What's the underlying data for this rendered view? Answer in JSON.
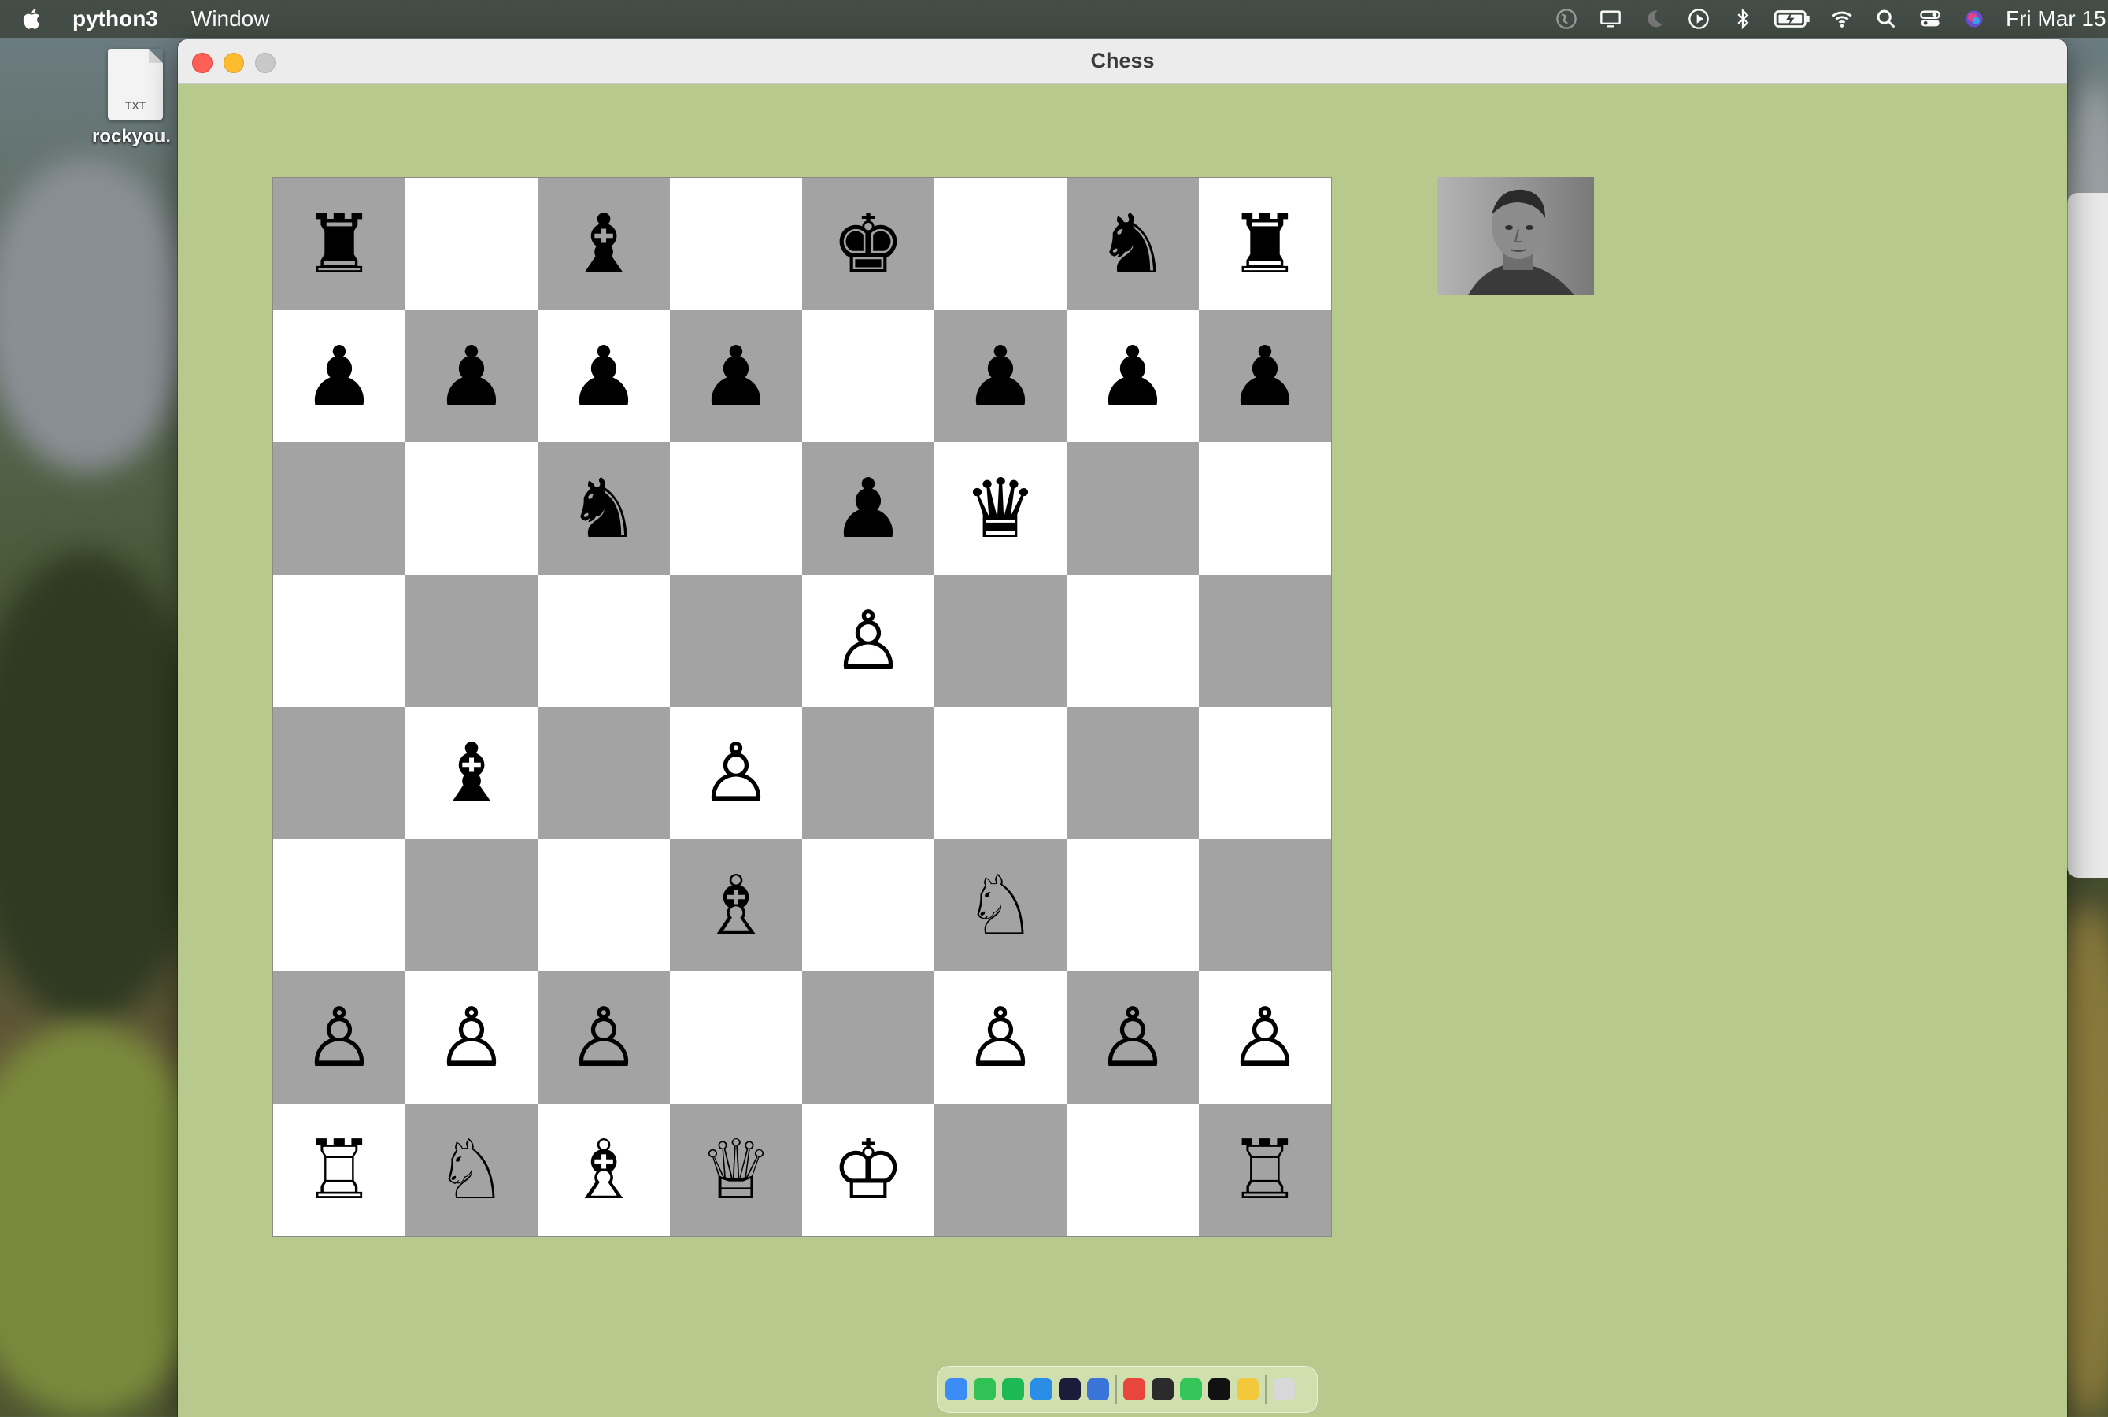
{
  "menubar": {
    "app_name": "python3",
    "menu_items": [
      "Window"
    ],
    "clock": "Fri Mar 15",
    "status_icons": [
      "globe-icon",
      "display-icon",
      "moon-icon",
      "play-icon",
      "bluetooth-icon",
      "battery-icon",
      "wifi-icon",
      "search-icon",
      "control-center-icon",
      "siri-icon"
    ]
  },
  "desktop": {
    "file": {
      "ext": "TXT",
      "name": "rockyou."
    }
  },
  "window": {
    "title": "Chess"
  },
  "board": {
    "light_color": "#ffffff",
    "dark_color": "#a3a3a3",
    "background_color": "#b7c98d",
    "ranks": [
      [
        "br",
        "",
        "bb",
        "",
        "bk",
        "",
        "bn",
        "br"
      ],
      [
        "bp",
        "bp",
        "bp",
        "bp",
        "",
        "bp",
        "bp",
        "bp"
      ],
      [
        "",
        "",
        "bn",
        "",
        "bp",
        "bq",
        "",
        ""
      ],
      [
        "",
        "",
        "",
        "",
        "wp",
        "",
        "",
        ""
      ],
      [
        "",
        "bb",
        "",
        "wp",
        "",
        "",
        "",
        ""
      ],
      [
        "",
        "",
        "",
        "wb",
        "",
        "wn",
        "",
        ""
      ],
      [
        "wp",
        "wp",
        "wp",
        "",
        "",
        "wp",
        "wp",
        "wp"
      ],
      [
        "wr",
        "wn",
        "wb",
        "wq",
        "wk",
        "",
        "",
        "wr"
      ]
    ]
  },
  "glyphs": {
    "bk": "♚",
    "bq": "♛",
    "br": "♜",
    "bb": "♝",
    "bn": "♞",
    "bp": "♟",
    "wk": "♔",
    "wq": "♕",
    "wr": "♖",
    "wb": "♗",
    "wn": "♘",
    "wp": "♙"
  },
  "piece_names": {
    "k": "king",
    "q": "queen",
    "r": "rook",
    "b": "bishop",
    "n": "knight",
    "p": "pawn",
    "b_": "black",
    "w_": "white"
  },
  "dock": {
    "apps": [
      {
        "name": "finder",
        "color": "#3b8df5"
      },
      {
        "name": "facetime",
        "color": "#30c254"
      },
      {
        "name": "spotify",
        "color": "#1db954"
      },
      {
        "name": "vscode",
        "color": "#2a8ee6"
      },
      {
        "name": "intellij",
        "color": "#1b1b3a"
      },
      {
        "name": "xcode",
        "color": "#3a74d9"
      },
      {
        "sep": true
      },
      {
        "name": "chrome",
        "color": "#e8453c"
      },
      {
        "name": "terminal-dark",
        "color": "#2b2b2b"
      },
      {
        "name": "messages",
        "color": "#35c659"
      },
      {
        "name": "terminal",
        "color": "#111111"
      },
      {
        "name": "cyberduck",
        "color": "#f3c93c"
      },
      {
        "sep": true
      },
      {
        "name": "trash",
        "color": "#d8d8d8"
      }
    ]
  }
}
